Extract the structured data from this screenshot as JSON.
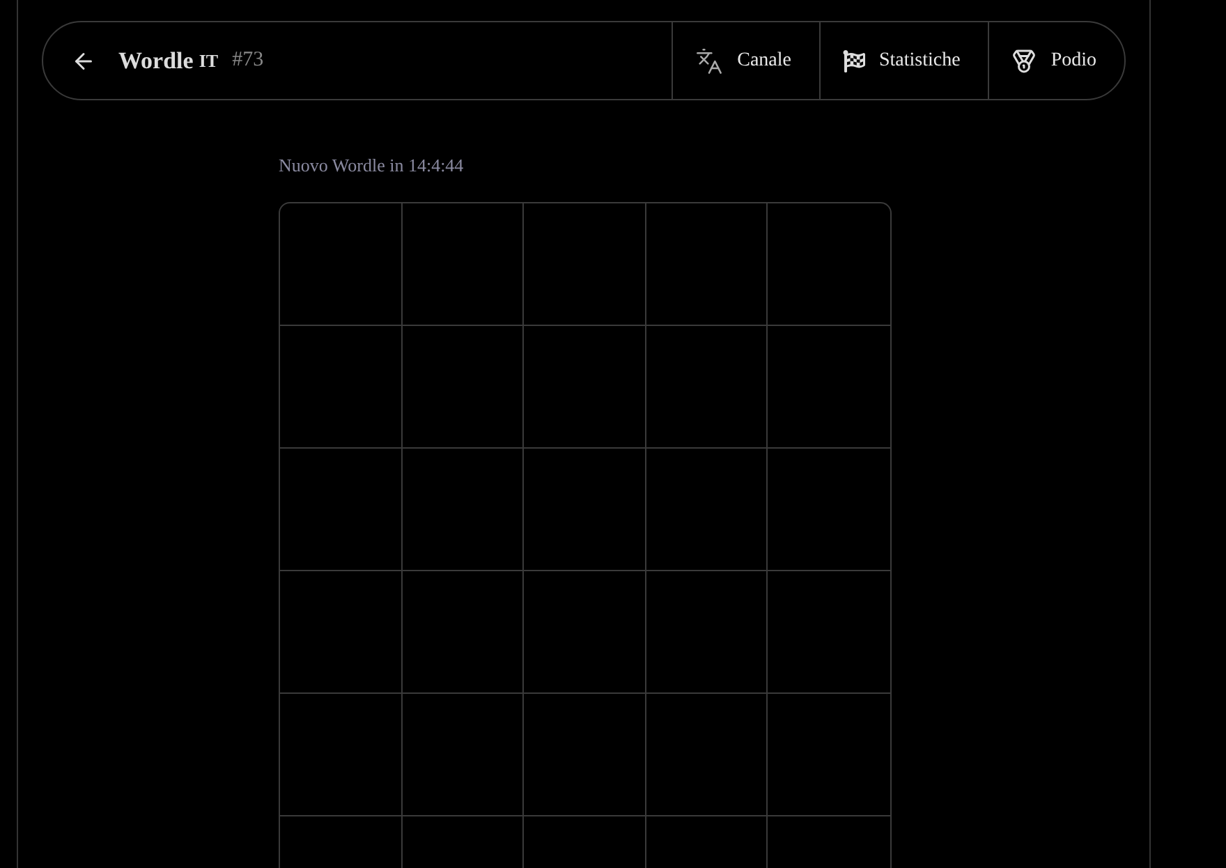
{
  "header": {
    "title": "Wordle",
    "badge": "IT",
    "number": "#73",
    "actions": [
      {
        "kind": "language",
        "label": "Canale"
      },
      {
        "kind": "stats",
        "label": "Statistiche"
      },
      {
        "kind": "podium",
        "label": "Podio"
      }
    ]
  },
  "countdown": "Nuovo Wordle in 14:4:44"
}
